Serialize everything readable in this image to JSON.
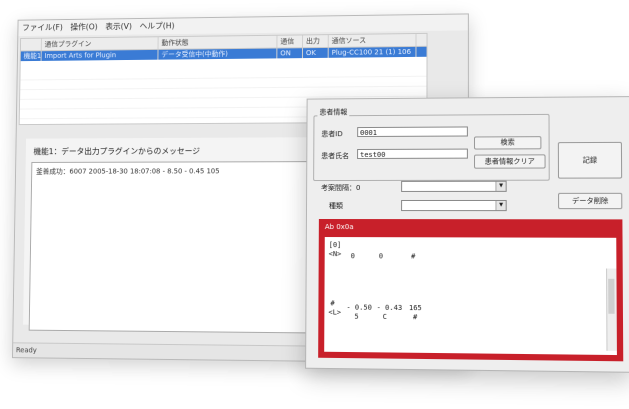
{
  "menu": [
    "ファイル(F)",
    "操作(O)",
    "表示(V)",
    "ヘルプ(H)"
  ],
  "grid": {
    "headers": [
      "",
      "通信プラグイン",
      "動作状態",
      "通信",
      "出力",
      "通信ソース"
    ],
    "rows": [
      [
        "機能1",
        "Import Arts for Plugin",
        "データ受信中(中動作)",
        "ON",
        "OK",
        "Plug-CC100 21 (1) 106"
      ]
    ]
  },
  "message": {
    "title": "機能1：データ出力プラグインからのメッセージ",
    "line": "釜善成功：6007 2005-18-30 18:07:08 - 8.50 - 0.45 105"
  },
  "status": "Ready",
  "dialog": {
    "group_title": "患者情報",
    "id_label": "患者ID",
    "id_value": "0001",
    "name_label": "患者氏名",
    "name_value": "test00",
    "search_button": "検索",
    "clear_button": "患者情報クリア",
    "interval_label": "考案間隔：0",
    "kind_label": "種類",
    "right_button_1": "記録",
    "right_button_2": "データ削除",
    "panel_title": "Ab 0x0a",
    "output": {
      "head1": "[0]",
      "head2": "<N>",
      "row1": [
        "0",
        "0",
        "#"
      ],
      "mark": "#",
      "label": "<L>",
      "row2": [
        "- 0.50",
        "- 0.43",
        "165"
      ],
      "row2_sub": [
        "5",
        "C",
        "#"
      ]
    }
  }
}
